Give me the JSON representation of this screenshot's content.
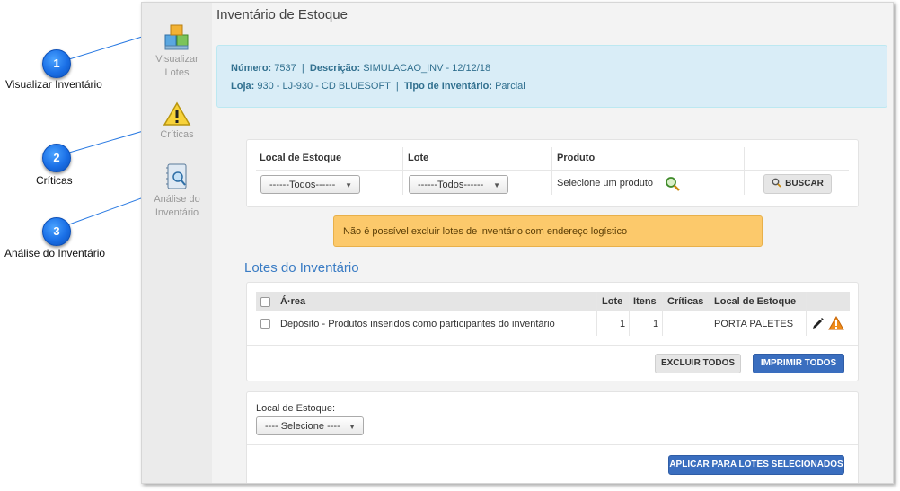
{
  "callouts": [
    {
      "number": "1",
      "label": "Visualizar Inventário"
    },
    {
      "number": "2",
      "label": "Críticas"
    },
    {
      "number": "3",
      "label": "Análise do Inventário"
    }
  ],
  "sidebar": {
    "items": [
      {
        "label_line1": "Visualizar",
        "label_line2": "Lotes",
        "icon": "boxes-icon"
      },
      {
        "label_line1": "Críticas",
        "icon": "warning-triangle-icon"
      },
      {
        "label_line1": "Análise do",
        "label_line2": "Inventário",
        "icon": "notebook-magnifier-icon"
      }
    ]
  },
  "page_title": "Inventário de Estoque",
  "info": {
    "numero_label": "Número:",
    "numero_value": "7537",
    "descricao_label": "Descrição:",
    "descricao_value": "SIMULACAO_INV - 12/12/18",
    "loja_label": "Loja:",
    "loja_value": "930 - LJ-930 - CD BLUESOFT",
    "tipo_label": "Tipo de Inventário:",
    "tipo_value": "Parcial",
    "separator": "|"
  },
  "filters": {
    "local_label": "Local de Estoque",
    "local_value": "------Todos------",
    "lote_label": "Lote",
    "lote_value": "------Todos------",
    "produto_label": "Produto",
    "produto_placeholder": "Selecione um produto",
    "buscar_label": "BUSCAR"
  },
  "warning_text": "Não é possível excluir lotes de inventário com endereço logístico",
  "lotes": {
    "title": "Lotes do Inventário",
    "columns": [
      "Á·rea",
      "Lote",
      "Itens",
      "Críticas",
      "Local de Estoque"
    ],
    "rows": [
      {
        "area": "Depósito - Produtos inseridos como participantes do inventário",
        "lote": "1",
        "itens": "1",
        "criticas": "",
        "local": "PORTA PALETES"
      }
    ],
    "excluir_label": "EXCLUIR TODOS",
    "imprimir_label": "IMPRIMIR TODOS"
  },
  "bulk": {
    "local_label": "Local de Estoque:",
    "local_value": "---- Selecione ----",
    "aplicar_label": "APLICAR PARA LOTES SELECIONADOS"
  },
  "colors": {
    "accent_blue": "#3a6ebf",
    "info_bg": "#d9edf7",
    "warning_bg": "#fcc96b",
    "callout_blue": "#1a6fe6"
  }
}
